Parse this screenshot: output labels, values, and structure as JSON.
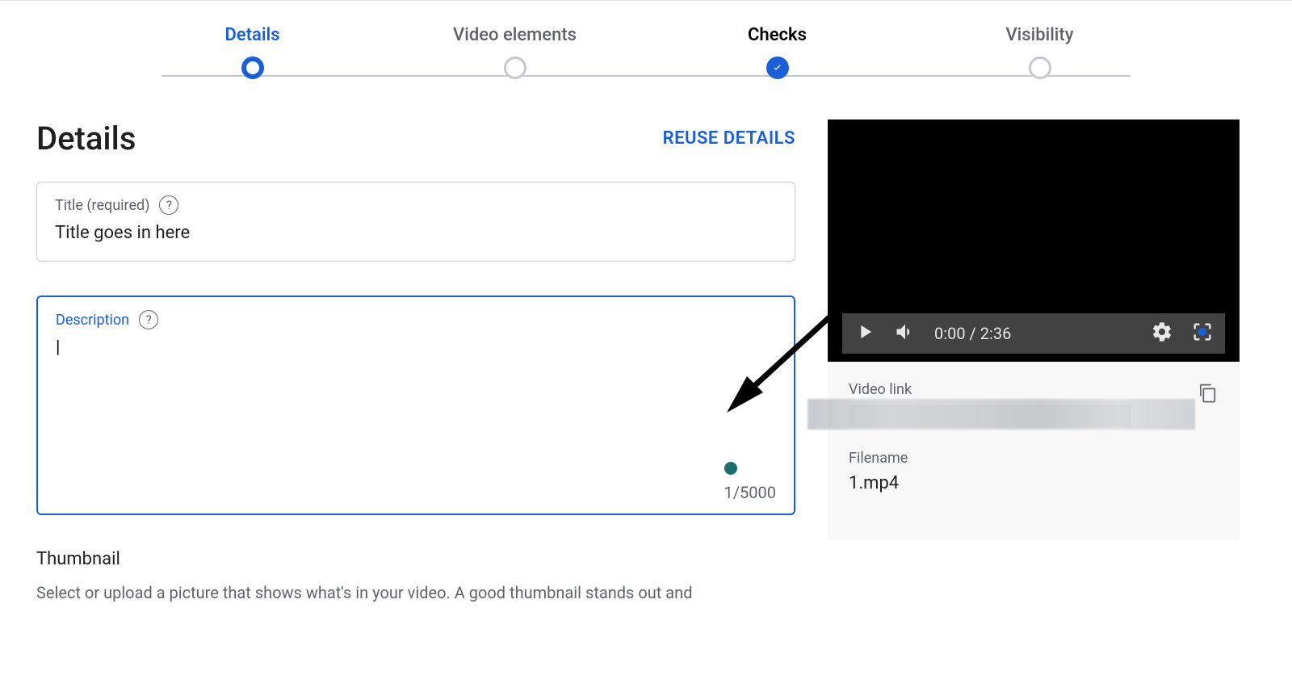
{
  "stepper": {
    "steps": [
      {
        "label": "Details"
      },
      {
        "label": "Video elements"
      },
      {
        "label": "Checks"
      },
      {
        "label": "Visibility"
      }
    ]
  },
  "heading": "Details",
  "reuse_label": "REUSE DETAILS",
  "title_field": {
    "label": "Title (required)",
    "value": "Title goes in here"
  },
  "description_field": {
    "label": "Description",
    "value": "",
    "counter": "1/5000"
  },
  "thumbnail": {
    "heading": "Thumbnail",
    "desc": "Select or upload a picture that shows what's in your video. A good thumbnail stands out and"
  },
  "video": {
    "time": "0:00 / 2:36",
    "link_label": "Video link",
    "filename_label": "Filename",
    "filename_value": "1.mp4"
  }
}
